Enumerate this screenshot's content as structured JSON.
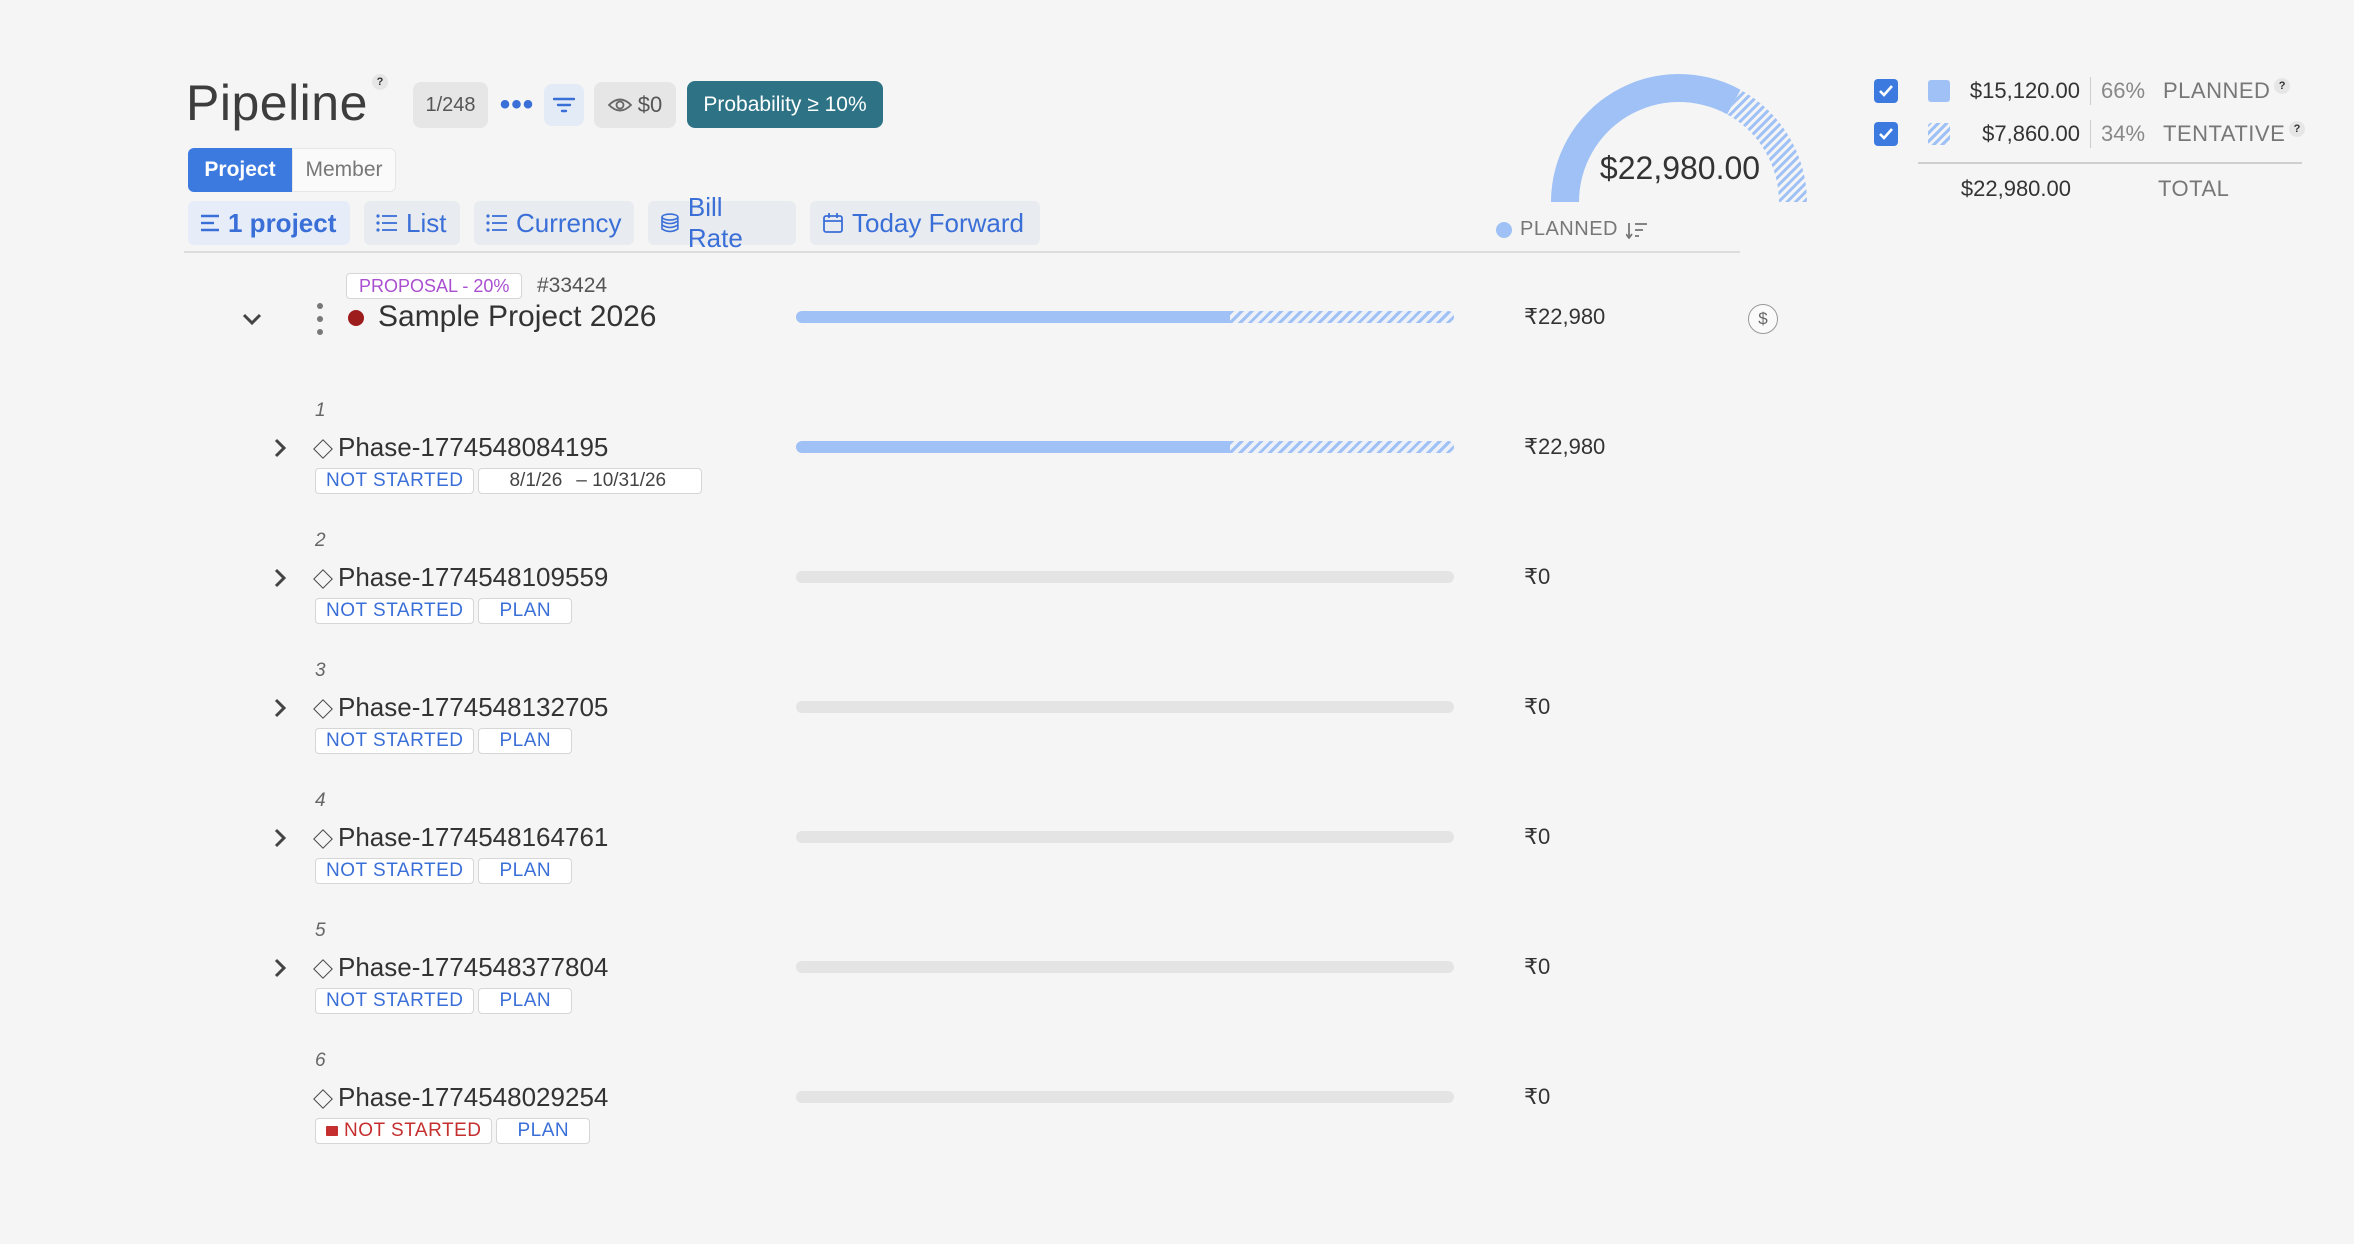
{
  "header": {
    "title": "Pipeline",
    "help_mark": "?",
    "count": "1/248",
    "more": "•••",
    "eye_value": "$0",
    "probability_filter": "Probability ≥ 10%"
  },
  "view_toggle": {
    "project": "Project",
    "member": "Member"
  },
  "toolbar": {
    "projects": "1 project",
    "list": "List",
    "currency": "Currency",
    "bill_rate": "Bill Rate",
    "today_forward": "Today Forward"
  },
  "gauge": {
    "total": "$22,980.00",
    "planned_fraction": 0.66,
    "tentative_fraction": 0.34,
    "colors": {
      "planned": "#9fc1f5",
      "track": "#e6e6e6"
    }
  },
  "column_header": {
    "label": "PLANNED"
  },
  "legend": {
    "planned": {
      "amount": "$15,120.00",
      "pct": "66%",
      "label": "PLANNED",
      "help": "?"
    },
    "tentative": {
      "amount": "$7,860.00",
      "pct": "34%",
      "label": "TENTATIVE",
      "help": "?"
    },
    "total": {
      "amount": "$22,980.00",
      "label": "TOTAL"
    }
  },
  "project": {
    "stage": "PROPOSAL - 20%",
    "id": "#33424",
    "name": "Sample Project 2026",
    "amount": "₹22,980",
    "planned_fraction": 0.66,
    "tentative_fraction": 0.34,
    "dollar_icon": "$",
    "status_color": "#9d1c1c"
  },
  "phases": [
    {
      "index": "1",
      "name": "Phase-1774548084195",
      "status": "NOT STARTED",
      "date_start": "8/1/26",
      "date_end": "– 10/31/26",
      "amount": "₹22,980",
      "planned_fraction": 0.66,
      "tentative_fraction": 0.34
    },
    {
      "index": "2",
      "name": "Phase-1774548109559",
      "status": "NOT STARTED",
      "plan": "PLAN",
      "amount": "₹0",
      "planned_fraction": 0,
      "tentative_fraction": 0
    },
    {
      "index": "3",
      "name": "Phase-1774548132705",
      "status": "NOT STARTED",
      "plan": "PLAN",
      "amount": "₹0",
      "planned_fraction": 0,
      "tentative_fraction": 0
    },
    {
      "index": "4",
      "name": "Phase-1774548164761",
      "status": "NOT STARTED",
      "plan": "PLAN",
      "amount": "₹0",
      "planned_fraction": 0,
      "tentative_fraction": 0
    },
    {
      "index": "5",
      "name": "Phase-1774548377804",
      "status": "NOT STARTED",
      "plan": "PLAN",
      "amount": "₹0",
      "planned_fraction": 0,
      "tentative_fraction": 0
    },
    {
      "index": "6",
      "name": "Phase-1774548029254",
      "status": "NOT STARTED",
      "plan": "PLAN",
      "amount": "₹0",
      "planned_fraction": 0,
      "tentative_fraction": 0,
      "status_red": true
    }
  ]
}
